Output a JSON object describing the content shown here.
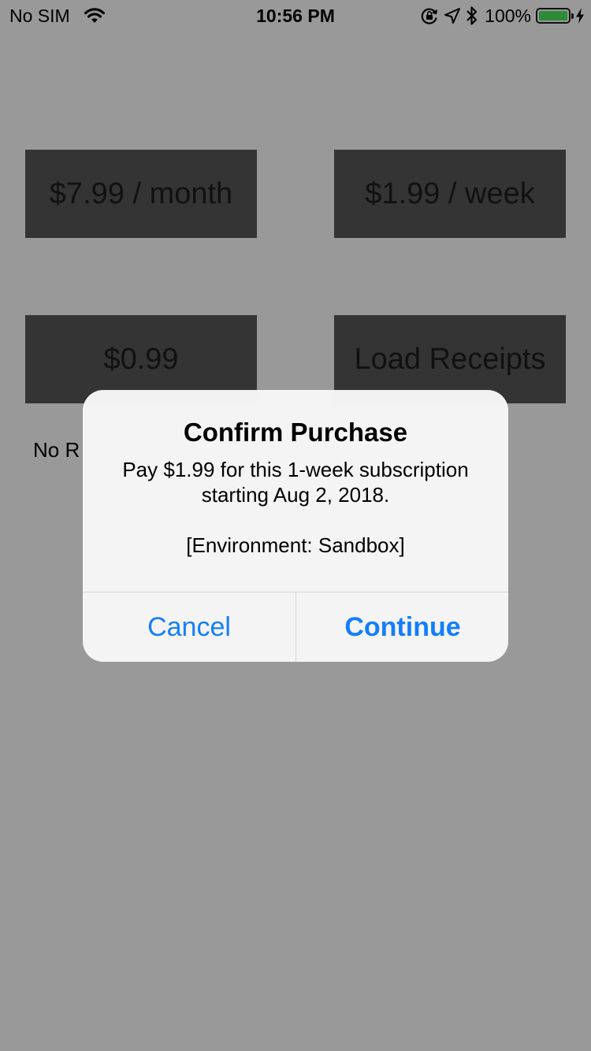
{
  "status_bar": {
    "carrier": "No SIM",
    "time": "10:56 PM",
    "battery_percent": "100%",
    "battery_color": "#2e8a37",
    "icons": [
      "wifi-icon",
      "orientation-lock-icon",
      "location-arrow-icon",
      "bluetooth-icon",
      "battery-icon",
      "charging-bolt-icon"
    ]
  },
  "products": {
    "monthly_label": "$7.99 / month",
    "weekly_label": "$1.99 / week",
    "single_label": "$0.99",
    "load_receipts_label": "Load Receipts"
  },
  "receipt_status": "No R",
  "alert": {
    "title": "Confirm Purchase",
    "message_line1": "Pay $1.99 for this 1-week subscription",
    "message_line2": "starting Aug 2, 2018.",
    "environment": "[Environment: Sandbox]",
    "cancel_label": "Cancel",
    "continue_label": "Continue",
    "button_color": "#147efb"
  },
  "colors": {
    "dimmed_background": "#999999",
    "product_button": "#343434"
  }
}
